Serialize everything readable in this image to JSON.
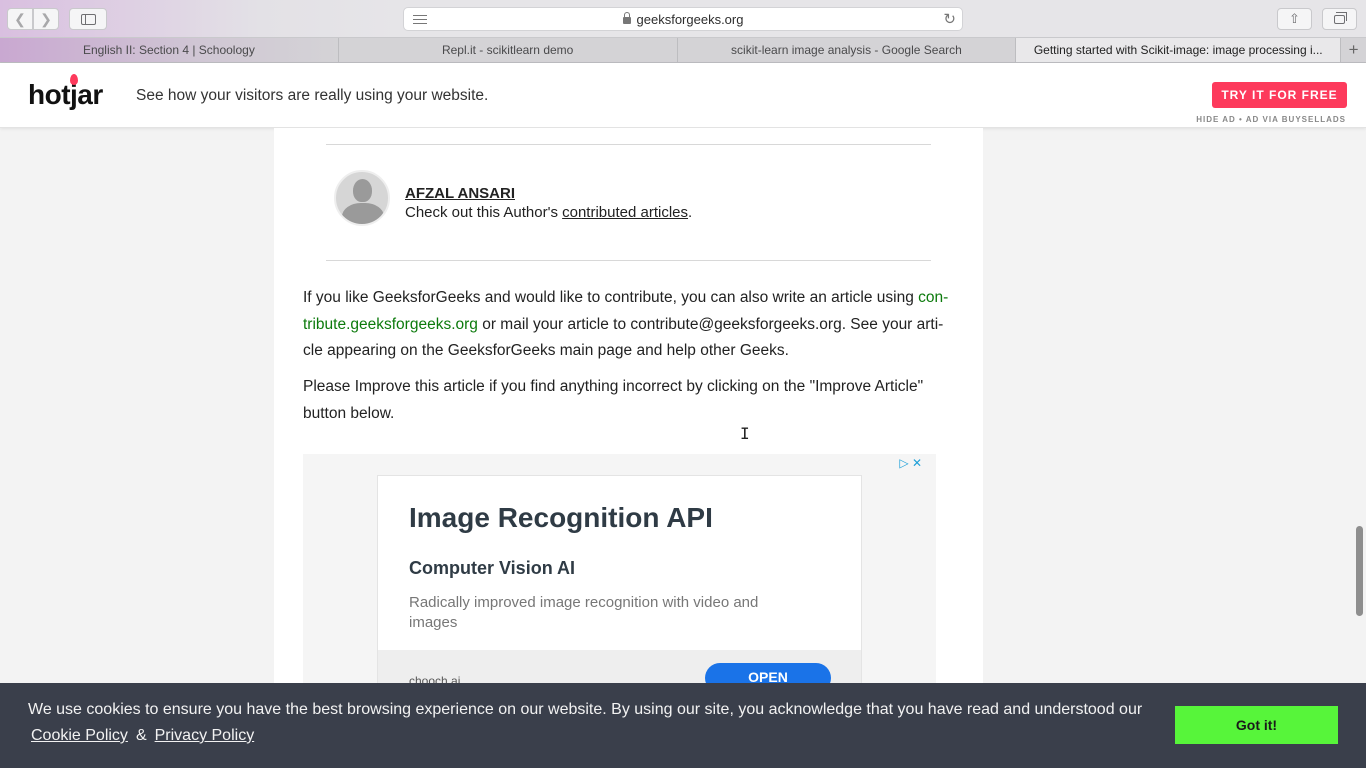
{
  "browser": {
    "url": "geeksforgeeks.org",
    "tabs": [
      {
        "label": "English II: Section 4 | Schoology"
      },
      {
        "label": "Repl.it - scikitlearn demo"
      },
      {
        "label": "scikit-learn image analysis - Google Search"
      },
      {
        "label": "Getting started with Scikit-image: image processing i..."
      }
    ],
    "new_tab_symbol": "+"
  },
  "ad_banner": {
    "brand": "hotjar",
    "tagline": "See how your visitors are really using your website.",
    "cta": "TRY IT FOR FREE",
    "via": "HIDE AD • AD VIA BUYSELLADS",
    "cta_color": "#fd3a5c"
  },
  "author": {
    "name": "AFZAL ANSARI",
    "line_prefix": "Check out this Author's ",
    "line_link": "contributed articles",
    "line_suffix": "."
  },
  "article": {
    "contribute_p1": "If you like GeeksforGeeks and would like to contribute, you can also write an article using ",
    "contribute_link_a": "con-",
    "contribute_link_b": "tribute.geeksforgeeks.org",
    "contribute_p2": " or mail your article to contribute@geeksforgeeks.org. See your arti-",
    "contribute_p3": "cle appearing on the GeeksforGeeks main page and help other Geeks.",
    "improve_p1": "Please Improve this article if you find anything incorrect by clicking on the \"Improve Article\"",
    "improve_p2": "button below."
  },
  "display_ad": {
    "title": "Image Recognition API",
    "subtitle": "Computer Vision AI",
    "description": "Radically improved image recognition with video and images",
    "domain": "chooch.ai",
    "button": "OPEN"
  },
  "cookie_bar": {
    "text": "We use cookies to ensure you have the best browsing experience on our website. By using our site, you acknowledge that you have read and understood our",
    "cookie_policy": "Cookie Policy",
    "amp": "&",
    "privacy_policy": "Privacy Policy",
    "button": "Got it!",
    "button_color": "#57f53a"
  }
}
